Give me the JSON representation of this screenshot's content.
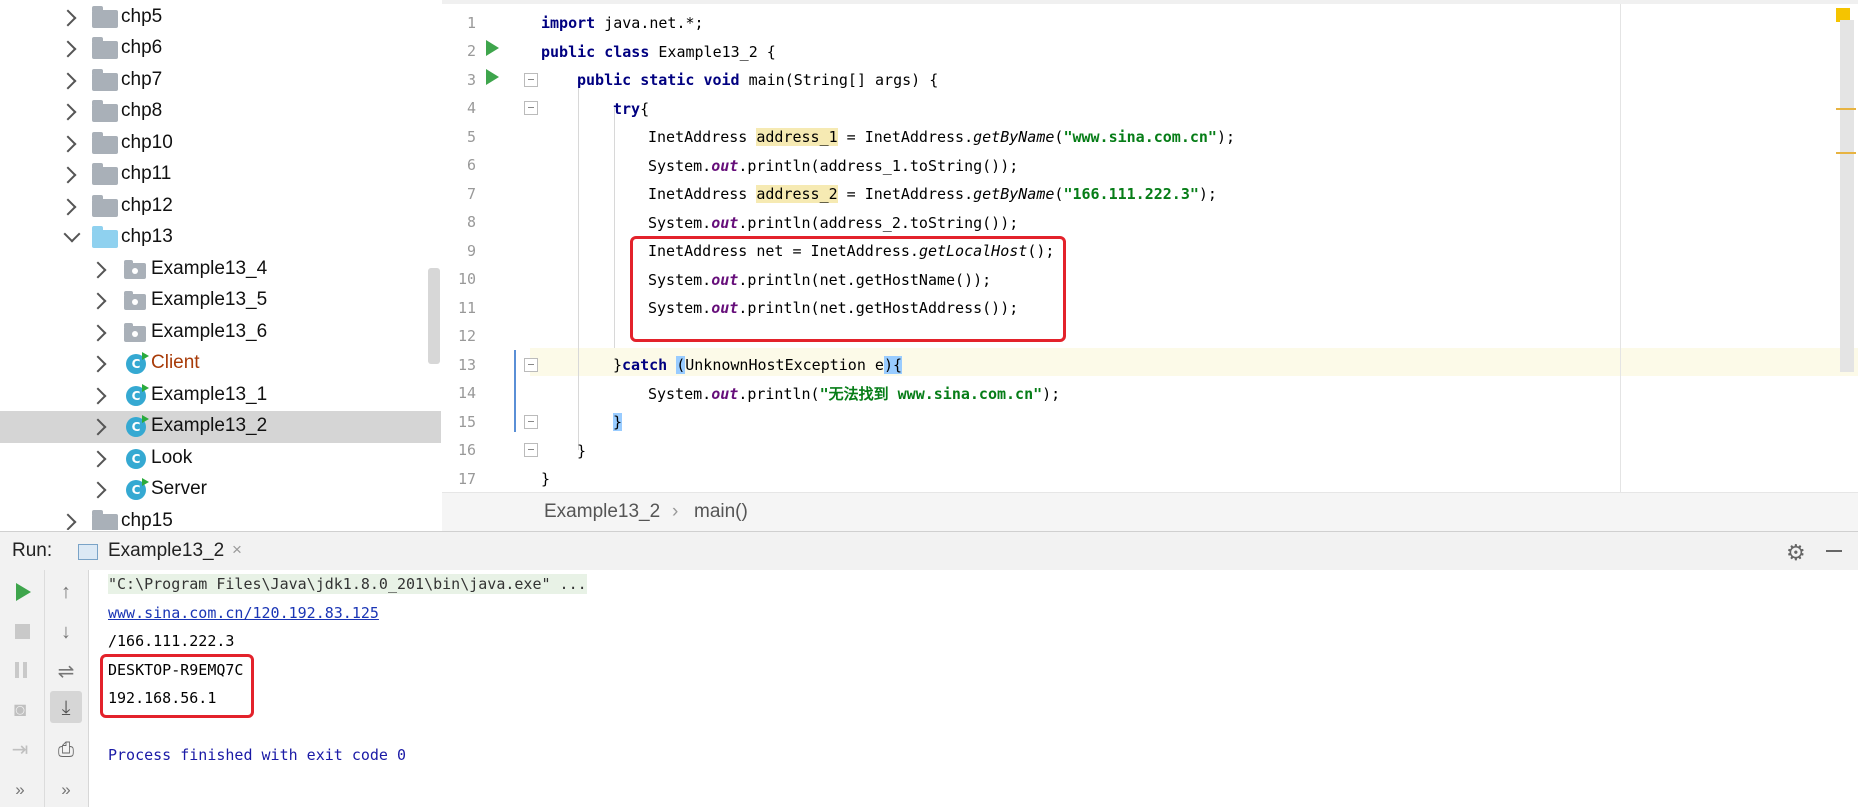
{
  "project_tree": {
    "items": [
      {
        "label": "chp5",
        "kind": "folder",
        "expanded": false
      },
      {
        "label": "chp6",
        "kind": "folder",
        "expanded": false
      },
      {
        "label": "chp7",
        "kind": "folder",
        "expanded": false
      },
      {
        "label": "chp8",
        "kind": "folder",
        "expanded": false
      },
      {
        "label": "chp10",
        "kind": "folder",
        "expanded": false
      },
      {
        "label": "chp11",
        "kind": "folder",
        "expanded": false
      },
      {
        "label": "chp12",
        "kind": "folder",
        "expanded": false
      },
      {
        "label": "chp13",
        "kind": "folder",
        "expanded": true
      },
      {
        "label": "Example13_4",
        "kind": "package"
      },
      {
        "label": "Example13_5",
        "kind": "package"
      },
      {
        "label": "Example13_6",
        "kind": "package"
      },
      {
        "label": "Client",
        "kind": "class"
      },
      {
        "label": "Example13_1",
        "kind": "class"
      },
      {
        "label": "Example13_2",
        "kind": "class",
        "selected": true
      },
      {
        "label": "Look",
        "kind": "class"
      },
      {
        "label": "Server",
        "kind": "class"
      },
      {
        "label": "chp15",
        "kind": "folder",
        "expanded": false
      }
    ],
    "class_icon_letter": "C"
  },
  "editor": {
    "line_numbers": [
      "1",
      "2",
      "3",
      "4",
      "5",
      "6",
      "7",
      "8",
      "9",
      "10",
      "11",
      "12",
      "13",
      "14",
      "15",
      "16",
      "17"
    ],
    "code": {
      "l1_kw": "import",
      "l1_rest": " java.net.*;",
      "l2_kw1": "public",
      "l2_kw2": "class",
      "l2_rest": " Example13_2 {",
      "l3_kw1": "public",
      "l3_kw2": "static",
      "l3_kw3": "void",
      "l3_rest": " main(String[] args) {",
      "l4_kw": "try",
      "l4_rest": "{",
      "l5_a": "InetAddress ",
      "l5_var": "address_1",
      "l5_b": " = InetAddress.",
      "l5_fn": "getByName",
      "l5_c": "(",
      "l5_str": "\"www.sina.com.cn\"",
      "l5_d": ");",
      "l6_a": "System.",
      "l6_fld": "out",
      "l6_b": ".println(address_1.toString());",
      "l7_a": "InetAddress ",
      "l7_var": "address_2",
      "l7_b": " = InetAddress.",
      "l7_fn": "getByName",
      "l7_c": "(",
      "l7_str": "\"166.111.222.3\"",
      "l7_d": ");",
      "l8_a": "System.",
      "l8_fld": "out",
      "l8_b": ".println(address_2.toString());",
      "l9_a": "InetAddress net = InetAddress.",
      "l9_fn": "getLocalHost",
      "l9_b": "();",
      "l10_a": "System.",
      "l10_fld": "out",
      "l10_b": ".println(net.getHostName());",
      "l11_a": "System.",
      "l11_fld": "out",
      "l11_b": ".println(net.getHostAddress());",
      "l13_a": "}",
      "l13_kw": "catch",
      "l13_sp": " ",
      "l13_paren": "(",
      "l13_b": "UnknownHostException e",
      "l13_paren2": ")",
      "l13_brace": "{",
      "l14_a": "System.",
      "l14_fld": "out",
      "l14_b": ".println(",
      "l14_str": "\"无法找到 www.sina.com.cn\"",
      "l14_c": ");",
      "l15": "}",
      "l16": "}",
      "l17": "}"
    }
  },
  "breadcrumb": {
    "items": [
      "Example13_2",
      "main()"
    ],
    "separator": "›"
  },
  "run_window": {
    "label": "Run:",
    "tab_label": "Example13_2",
    "tab_close": "×",
    "settings_icon": "⚙"
  },
  "console": {
    "lines": [
      "\"C:\\Program Files\\Java\\jdk1.8.0_201\\bin\\java.exe\" ...",
      "www.sina.com.cn/120.192.83.125",
      "/166.111.222.3",
      "DESKTOP-R9EMQ7C",
      "192.168.56.1",
      "",
      "Process finished with exit code 0"
    ]
  },
  "colors": {
    "keyword": "#000080",
    "string": "#067d17",
    "static_field": "#660e7a",
    "highlight_box": "#e3222b",
    "run_green": "#3ea54c",
    "selection": "#d5d5d5"
  }
}
